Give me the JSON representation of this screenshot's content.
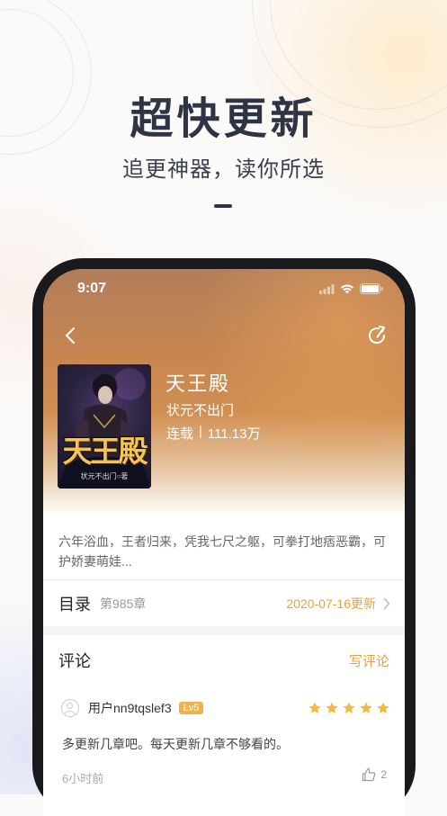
{
  "promo": {
    "headline": "超快更新",
    "subline": "追更神器，读你所选"
  },
  "status_bar": {
    "time": "9:07",
    "icons": [
      "signal-icon",
      "wifi-icon",
      "battery-icon"
    ]
  },
  "nav": {
    "back_icon": "chevron-left-icon",
    "share_icon": "share-icon"
  },
  "book": {
    "cover_title": "天王殿",
    "cover_author": "状元不出门○著",
    "title": "天王殿",
    "author": "状元不出门",
    "status": "连载",
    "separator": "|",
    "word_count": "111.13万",
    "description": "六年浴血，王者归来，凭我七尺之躯，可拳打地痞恶霸，可护娇妻萌娃..."
  },
  "toc": {
    "label": "目录",
    "chapter_count": "第985章",
    "updated": "2020-07-16更新"
  },
  "comments": {
    "title": "评论",
    "write_label": "写评论",
    "items": [
      {
        "username": "用户nn9tqslef3",
        "level": "Lv5",
        "rating": 5,
        "rating_max": 5,
        "text": "多更新几章吧。每天更新几章不够看的。",
        "time": "6小时前",
        "likes": "2"
      }
    ]
  },
  "colors": {
    "accent": "#e8a23a",
    "headline": "#2e3446",
    "level_badge": "#f0b24a",
    "star": "#f6b93b"
  }
}
